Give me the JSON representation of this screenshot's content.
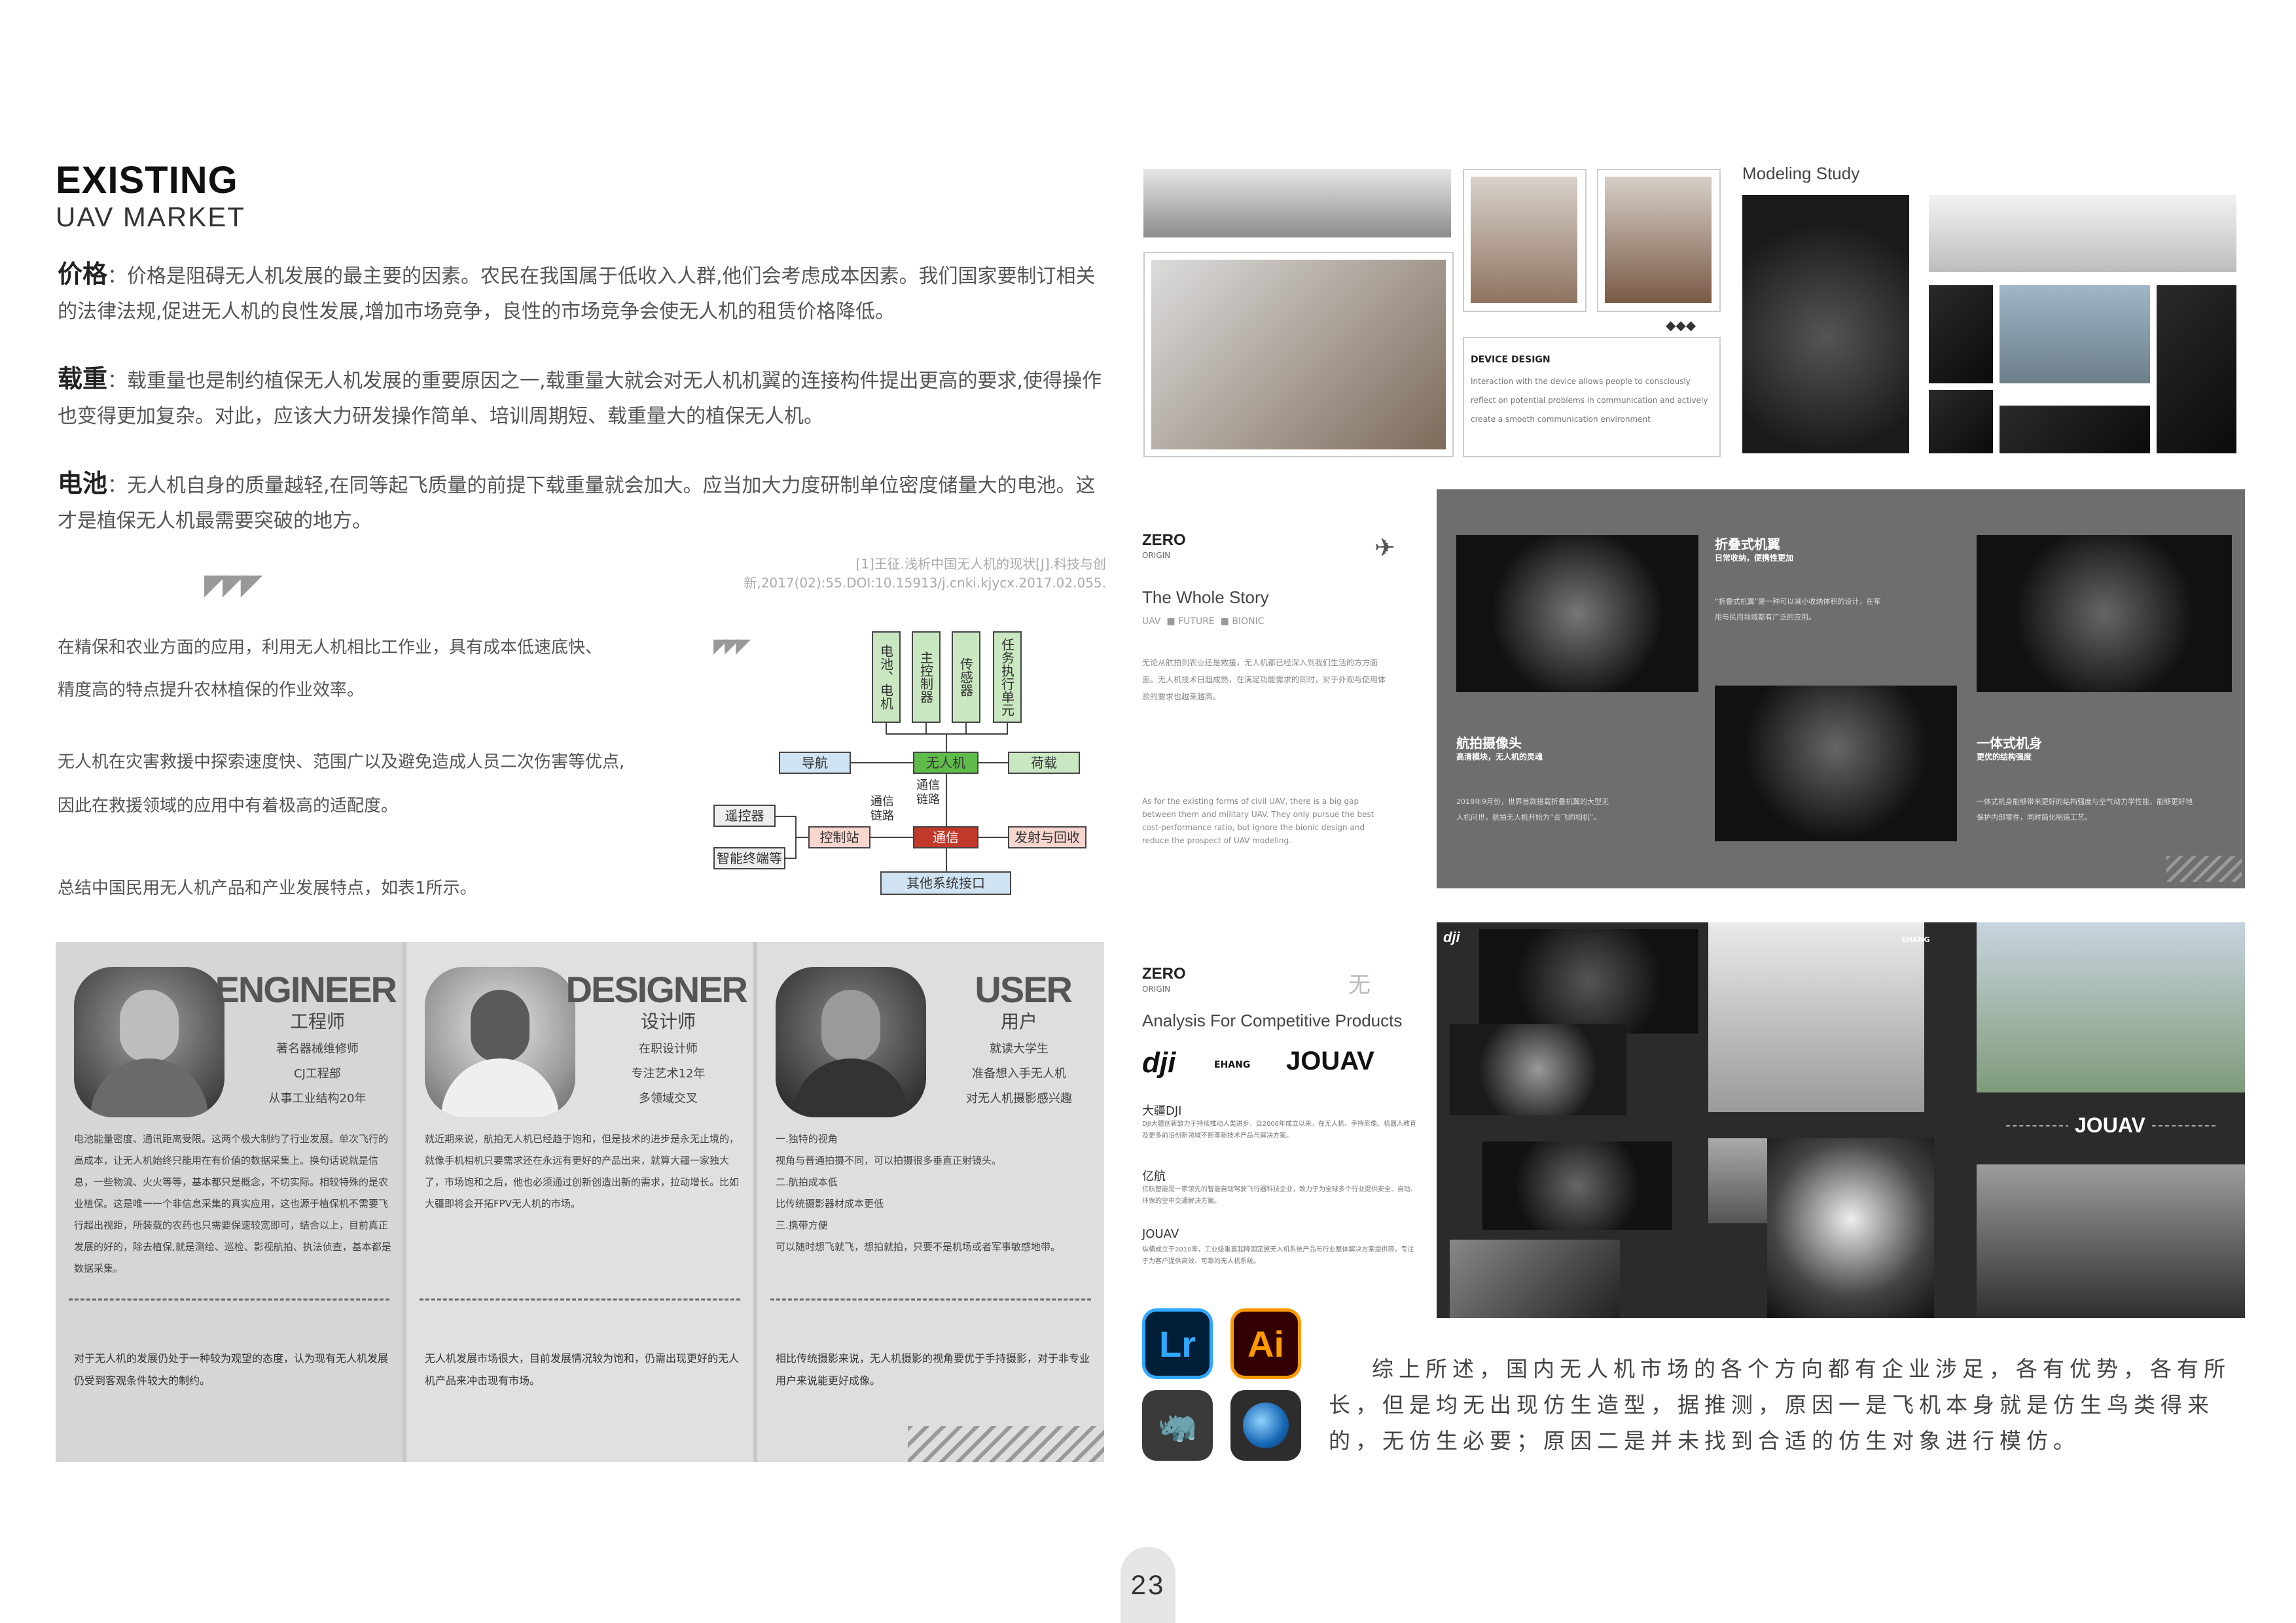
{
  "header": {
    "title": "EXISTING",
    "subtitle": "UAV MARKET"
  },
  "factors": [
    {
      "label": "价格",
      "text": "：价格是阻碍无人机发展的最主要的因素。农民在我国属于低收入人群,他们会考虑成本因素。我们国家要制订相关的法律法规,促进无人机的良性发展,增加市场竞争，良性的市场竞争会使无人机的租赁价格降低。"
    },
    {
      "label": "载重",
      "text": "：载重量也是制约植保无人机发展的重要原因之一,载重量大就会对无人机机翼的连接构件提出更高的要求,使得操作也变得更加复杂。对此，应该大力研发操作简单、培训周期短、载重量大的植保无人机。"
    },
    {
      "label": "电池",
      "text": "：无人机自身的质量越轻,在同等起飞质量的前提下载重量就会加大。应当加大力度研制单位密度储量大的电池。这才是植保无人机最需要突破的地方。"
    }
  ],
  "citation": "[1]王征.浅析中国无人机的现状[J].科技与创新,2017(02):55.DOI:10.15913/j.cnki.kjycx.2017.02.055.",
  "applications": {
    "p1a": "在精保和农业方面的应用，利用无人机相比工作业，具有成本低速底快、",
    "p1b": "精度高的特点提升农林植保的作业效率。",
    "p2a": "无人机在灾害救援中探索速度快、范围广以及避免造成人员二次伤害等优点,",
    "p2b": "因此在救援领域的应用中有着极高的适配度。",
    "p3": "总结中国民用无人机产品和产业发展特点，如表1所示。"
  },
  "diagram": {
    "top": [
      "电池、电机",
      "主控制器",
      "传感器",
      "任务执行单元"
    ],
    "nav": "导航",
    "uav": "无人机",
    "payload": "荷载",
    "link1": "通信链路",
    "link2": "通信链路",
    "remote": "遥控器",
    "terminal": "智能终端等",
    "control": "控制站",
    "comm": "通信",
    "launch": "发射与回收",
    "iface": "其他系统接口"
  },
  "personas": [
    {
      "role": "ENGINEER",
      "role_cn": "工程师",
      "meta": [
        "著名器械维修师",
        "CJ工程部",
        "从事工业结构20年"
      ],
      "desc": "电池能量密度、通讯距离受限。这两个极大制约了行业发展。单次飞行的高成本，让无人机始终只能用在有价值的数据采集上。换句话说就是信息，一些物流、火火等等，基本都只是概念，不切实际。相较特殊的是农业植保。这是唯一一个非信息采集的真实应用，这也源于植保机不需要飞行超出视距，所装载的农药也只需要保速较宽即可，结合以上，目前真正发展的好的，除去植保,就是测绘、巡检、影视航拍、执法侦查，基本都是数据采集。",
      "concl": "对于无人机的发展仍处于一种较为观望的态度，认为现有无人机发展仍受到客观条件较大的制约。"
    },
    {
      "role": "DESIGNER",
      "role_cn": "设计师",
      "meta": [
        "在职设计师",
        "专注艺术12年",
        "多领域交叉"
      ],
      "desc": "就近期来说，航拍无人机已经趋于饱和，但是技术的进步是永无止境的，就像手机相机只要需求还在永远有更好的产品出来，就算大疆一家独大了，市场饱和之后，他也必须通过创新创造出新的需求，拉动增长。比如大疆即将会开拓FPV无人机的市场。",
      "concl": "无人机发展市场很大，目前发展情况较为饱和，仍需出现更好的无人机产品来冲击现有市场。"
    },
    {
      "role": "USER",
      "role_cn": "用户",
      "meta": [
        "就读大学生",
        "准备想入手无人机",
        "对无人机摄影感兴趣"
      ],
      "desc": "一.独特的视角\n视角与普通拍摄不同，可以拍摄很多垂直正射镜头。\n二.航拍成本低\n比传统摄影器材成本更低\n三.携带方便\n可以随时想飞就飞，想拍就拍，只要不是机场或者军事敏感地带。",
      "concl": "相比传统摄影来说，无人机摄影的视角要优于手持摄影，对于非专业用户来说能更好成像。"
    }
  ],
  "moodboard": {
    "modeling_label": "Modeling Study",
    "device_title": "DEVICE DESIGN",
    "device_text": "Interaction with the device allows people to consciously reflect on potential problems in communication and actively create a smooth communication environment"
  },
  "story": {
    "brand": "ZERO",
    "brand_sub": "ORIGIN",
    "heading": "The Whole Story",
    "tags": [
      "UAV",
      "FUTURE",
      "BIONIC"
    ],
    "body_cn": "无论从航拍到农业还是救援，无人机都已经深入到我们生活的方方面面。无人机技术日趋成熟，在满足功能需求的同时，对于外观与使用体验的要求也越来越高。",
    "body_en": "As for the existing forms of civil UAV, there is a big gap between them and military UAV. They only pursue the best cost-performance ratio, but ignore the bionic design and reduce the prospect of UAV modeling.",
    "f1_title": "折叠式机翼",
    "f1_sub": "日常收纳，便携性更加",
    "f1_text": "“折叠式机翼”是一种可以减小收纳体积的设计，在军用与民用领域都有广泛的应用。",
    "f2_title": "航拍摄像头",
    "f2_sub": "高清模块，无人机的灵魂",
    "f2_text": "2018年9月份，世界首款搭载折叠机翼的大型无人机问世，航拍无人机开始为“会飞的相机”。",
    "f3_title": "一体式机身",
    "f3_sub": "更优的结构强度",
    "f3_text": "一体式机身能够带来更好的结构强度与空气动力学性能，能够更好地保护内部零件，同时简化制造工艺。"
  },
  "competitors": {
    "brand": "ZERO",
    "brand_sub": "ORIGIN",
    "heading": "Analysis For Competitive Products",
    "logos": [
      "dji",
      "EHANG",
      "JOUAV"
    ],
    "items": [
      {
        "name": "大疆DJI",
        "text": "DJI大疆创新致力于持续推动人类进步，自2006年成立以来，在无人机、手持影像、机器人教育及更多前沿创新领域不断革新技术产品与解决方案。"
      },
      {
        "name": "亿航",
        "text": "亿航智能是一家领先的智能自动驾驶飞行器科技企业，致力于为全球多个行业提供安全、自动、环保的空中交通解决方案。"
      },
      {
        "name": "JOUAV",
        "text": "纵横成立于2010年，工业级垂直起降固定翼无人机系统产品与行业整体解决方案提供商，专注于为客户提供高效、可靠的无人机系统。"
      }
    ],
    "photo_tags": [
      "dji",
      "EHANG",
      "JOUAV"
    ]
  },
  "apps": [
    {
      "name": "Lr",
      "color": "#31A8FF",
      "bg": "#001E36"
    },
    {
      "name": "Ai",
      "color": "#FF9A00",
      "bg": "#330000"
    }
  ],
  "summary": "综上所述，国内无人机市场的各个方向都有企业涉足，各有优势，各有所长，但是均无出现仿生造型，据推测，原因一是飞机本身就是仿生鸟类得来的，无仿生必要；原因二是并未找到合适的仿生对象进行模仿。",
  "page_number": "23"
}
